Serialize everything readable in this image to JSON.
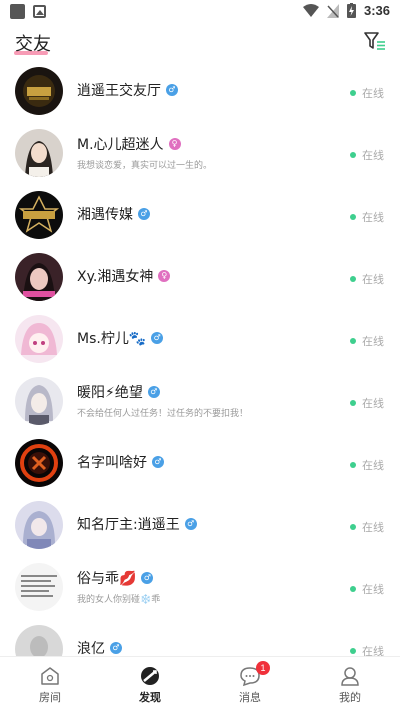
{
  "status_bar": {
    "time": "3:36"
  },
  "header": {
    "title": "交友",
    "filter_icon": "filter-icon"
  },
  "colors": {
    "accent": "#f04a7a",
    "online": "#3ecf8e",
    "male": "#4aa0e6",
    "female": "#e070c0"
  },
  "users": [
    {
      "name": "逍遥王交友厅",
      "gender": "male",
      "signature": "",
      "status": "在线"
    },
    {
      "name": "M.心儿超迷人",
      "gender": "female",
      "signature": "我想谈恋爱，真实可以过一生的。",
      "status": "在线"
    },
    {
      "name": "湘遇传媒",
      "gender": "male",
      "signature": "",
      "status": "在线"
    },
    {
      "name": "Xy.湘遇女神",
      "gender": "female",
      "signature": "",
      "status": "在线"
    },
    {
      "name": "Ms.柠儿🐾",
      "gender": "male",
      "signature": "",
      "status": "在线"
    },
    {
      "name": "暖阳⚡绝望",
      "gender": "male",
      "signature": "不会给任何人过任务！过任务的不要扣我！",
      "status": "在线"
    },
    {
      "name": "名字叫啥好",
      "gender": "male",
      "signature": "",
      "status": "在线"
    },
    {
      "name": "知名厅主:逍遥王",
      "gender": "male",
      "signature": "",
      "status": "在线"
    },
    {
      "name": "俗与乖💋",
      "gender": "male",
      "signature": "我的女人你别碰❄️乖",
      "status": "在线"
    },
    {
      "name": "浪亿",
      "gender": "male",
      "signature": "",
      "status": "在线"
    }
  ],
  "bottom_nav": [
    {
      "label": "房间",
      "icon": "home-icon"
    },
    {
      "label": "发现",
      "icon": "discover-icon"
    },
    {
      "label": "消息",
      "icon": "message-icon",
      "badge": "1"
    },
    {
      "label": "我的",
      "icon": "profile-icon"
    }
  ]
}
